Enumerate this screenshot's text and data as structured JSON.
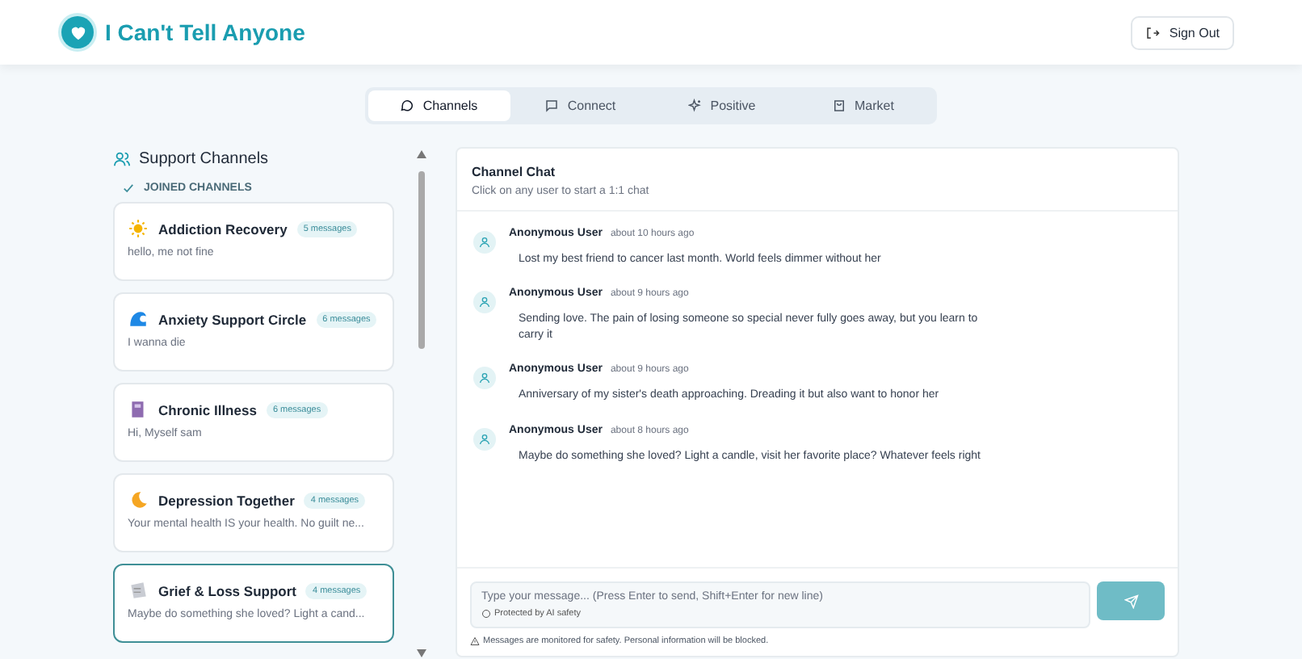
{
  "header": {
    "title": "I Can't Tell Anyone",
    "sign_out": "Sign Out"
  },
  "tabs": [
    {
      "label": "Channels",
      "selected": true
    },
    {
      "label": "Connect",
      "selected": false
    },
    {
      "label": "Positive",
      "selected": false
    },
    {
      "label": "Market",
      "selected": false
    }
  ],
  "sidebar": {
    "title": "Support Channels",
    "section": "JOINED CHANNELS",
    "channels": [
      {
        "name": "Addiction Recovery",
        "count": "5 messages",
        "preview": "hello, me not fine",
        "selected": false
      },
      {
        "name": "Anxiety Support Circle",
        "count": "6 messages",
        "preview": "I wanna die",
        "selected": false
      },
      {
        "name": "Chronic Illness",
        "count": "6 messages",
        "preview": "Hi, Myself sam",
        "selected": false
      },
      {
        "name": "Depression Together",
        "count": "4 messages",
        "preview": "Your mental health IS your health. No guilt ne...",
        "selected": false
      },
      {
        "name": "Grief & Loss Support",
        "count": "4 messages",
        "preview": "Maybe do something she loved? Light a cand...",
        "selected": true
      }
    ]
  },
  "chat": {
    "title": "Channel Chat",
    "subtitle": "Click on any user to start a 1:1 chat",
    "messages": [
      {
        "user": "Anonymous User",
        "time": "about 10 hours ago",
        "text": "Lost my best friend to cancer last month. World feels dimmer without her"
      },
      {
        "user": "Anonymous User",
        "time": "about 9 hours ago",
        "text": "Sending love. The pain of losing someone so special never fully goes away, but you learn to carry it"
      },
      {
        "user": "Anonymous User",
        "time": "about 9 hours ago",
        "text": "Anniversary of my sister's death approaching. Dreading it but also want to honor her"
      },
      {
        "user": "Anonymous User",
        "time": "about 8 hours ago",
        "text": "Maybe do something she loved? Light a candle, visit her favorite place? Whatever feels right"
      }
    ],
    "input": {
      "placeholder": "Type your message... (Press Enter to send, Shift+Enter for new line)",
      "protected": "Protected by AI safety"
    },
    "notice": "Messages are monitored for safety. Personal information will be blocked."
  }
}
